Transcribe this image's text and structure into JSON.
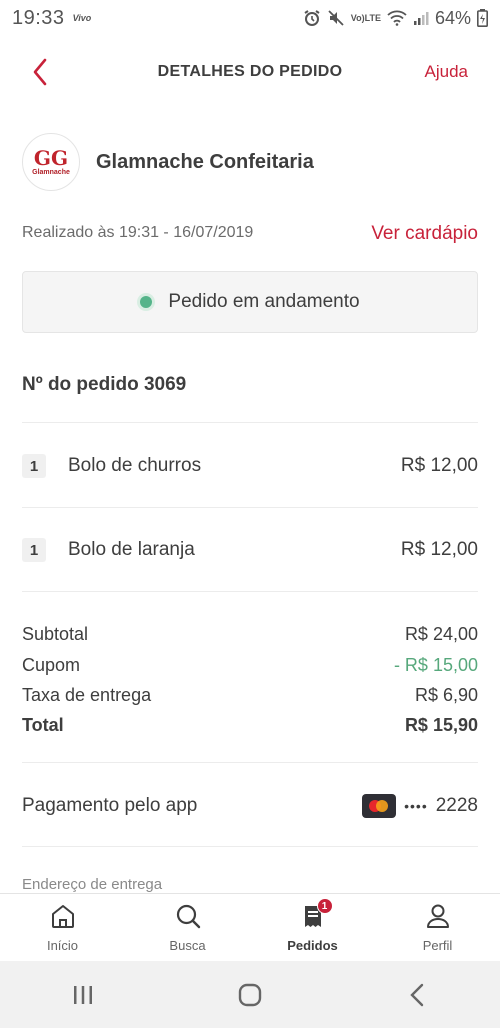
{
  "status_bar": {
    "time": "19:33",
    "carrier": "Vivo",
    "volte_top": "Vo)",
    "volte_bottom": "LTE",
    "battery_percent": "64%"
  },
  "header": {
    "title": "DETALHES DO PEDIDO",
    "help_label": "Ajuda"
  },
  "store": {
    "logo_mark": "GG",
    "logo_text": "Glamnache",
    "name": "Glamnache Confeitaria"
  },
  "order": {
    "placed_text": "Realizado às 19:31 - 16/07/2019",
    "menu_link": "Ver cardápio",
    "status_text": "Pedido em andamento",
    "number_text": "Nº do pedido 3069",
    "items": [
      {
        "qty": "1",
        "name": "Bolo de churros",
        "price": "R$ 12,00"
      },
      {
        "qty": "1",
        "name": "Bolo de laranja",
        "price": "R$ 12,00"
      }
    ],
    "summary": {
      "subtotal_label": "Subtotal",
      "subtotal_value": "R$ 24,00",
      "coupon_label": "Cupom",
      "coupon_value": "- R$ 15,00",
      "delivery_label": "Taxa de entrega",
      "delivery_value": "R$ 6,90",
      "total_label": "Total",
      "total_value": "R$ 15,90"
    },
    "payment_label": "Pagamento pelo app",
    "card_dots": "••••",
    "card_last4": "2228",
    "address_label": "Endereço de entrega"
  },
  "bottom_nav": {
    "items": [
      {
        "label": "Início",
        "icon": "home-icon"
      },
      {
        "label": "Busca",
        "icon": "search-icon"
      },
      {
        "label": "Pedidos",
        "icon": "orders-icon",
        "badge": "1"
      },
      {
        "label": "Perfil",
        "icon": "profile-icon"
      }
    ]
  },
  "colors": {
    "accent": "#c8223a",
    "status_green": "#55b48a",
    "coupon_green": "#57a87c"
  }
}
